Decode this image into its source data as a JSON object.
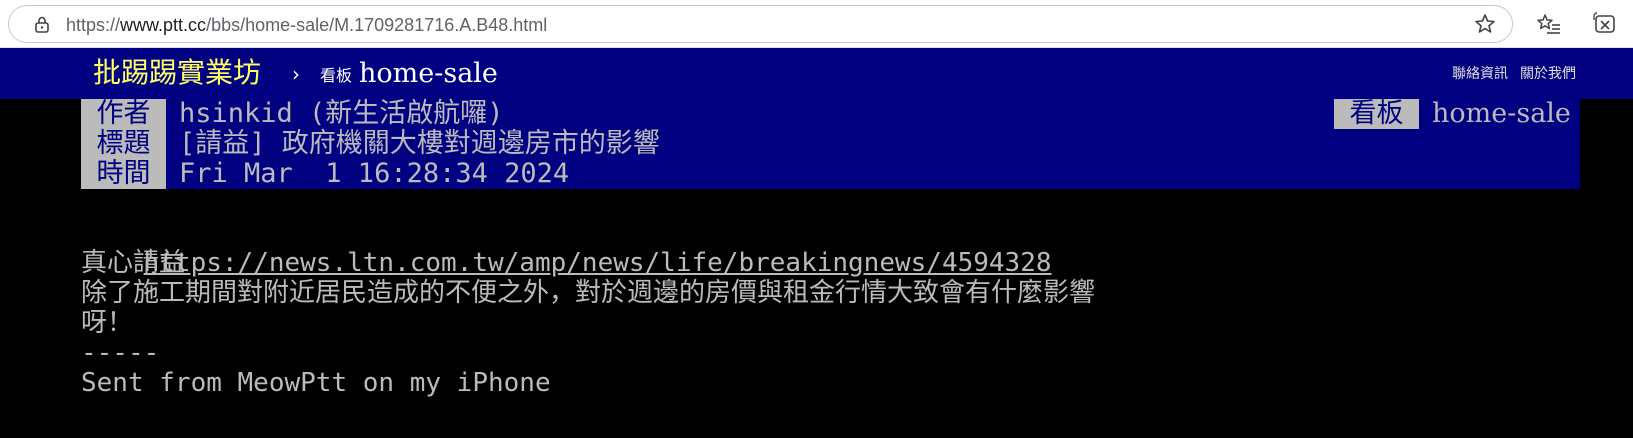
{
  "browser": {
    "url_prefix": "https://",
    "url_host": "www.ptt.cc",
    "url_path": "/bbs/home-sale/M.1709281716.A.B48.html",
    "icons": [
      "lock-icon",
      "star-icon",
      "favorites-icon",
      "collections-icon"
    ]
  },
  "topbar": {
    "logo": "批踢踢實業坊",
    "separator": "›",
    "board_label": "看板",
    "board_name": "home-sale",
    "links": [
      "聯絡資訊",
      "關於我們"
    ]
  },
  "meta": {
    "author_tag": "作者",
    "author": "hsinkid (新生活啟航囉)",
    "board_tag": "看板",
    "board": "home-sale",
    "title_tag": "標題",
    "title": "[請益] 政府機關大樓對週邊房市的影響",
    "time_tag": "時間",
    "time": "Fri Mar  1 16:28:34 2024"
  },
  "body": {
    "link": "https://news.ltn.com.tw/amp/news/life/breakingnews/4594328",
    "lines": [
      "真心請益",
      "除了施工期間對附近居民造成的不便之外，對於週邊的房價與租金行情大致會有什麼影響",
      "呀！",
      "-----",
      "Sent from MeowPtt on my iPhone"
    ]
  },
  "colors": {
    "header_bg": "#000080",
    "logo": "#ffff66",
    "tag_bg": "#bbbbbb",
    "text": "#bbbbbb",
    "page_bg": "#000000"
  }
}
